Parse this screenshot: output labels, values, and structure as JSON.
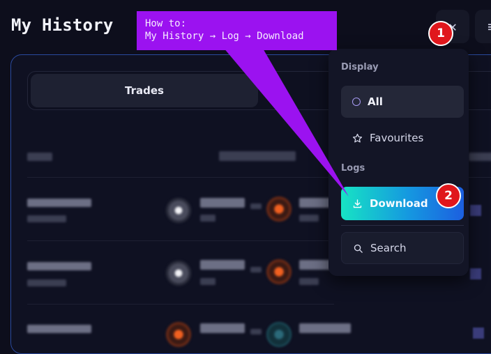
{
  "page": {
    "title": "My History"
  },
  "tabs": {
    "trades_label": "Trades"
  },
  "dropdown": {
    "display_label": "Display",
    "all_label": "All",
    "favourites_label": "Favourites",
    "logs_label": "Logs",
    "download_label": "Download",
    "search_label": "Search"
  },
  "callout": {
    "line1": "How to:",
    "line2": "My History → Log → Download"
  },
  "badges": {
    "first": "1",
    "second": "2"
  },
  "colors": {
    "accent_border": "#2a4a9e",
    "callout": "#9b12f0",
    "badge": "#e0171c",
    "download_gradient_start": "#17e3c4",
    "download_gradient_end": "#1c5fe0"
  }
}
